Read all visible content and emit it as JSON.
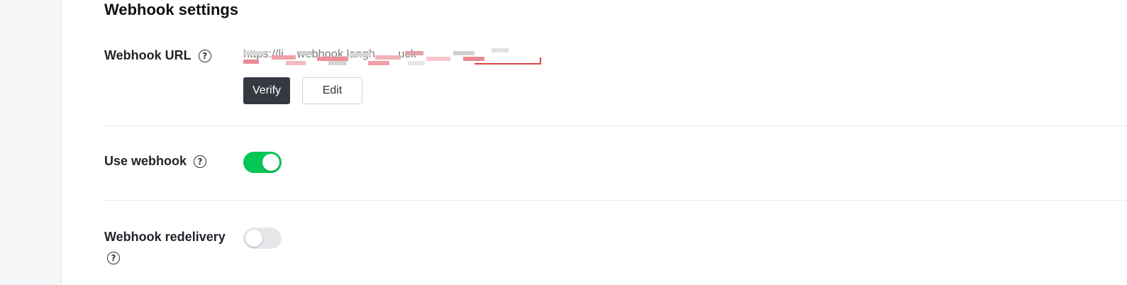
{
  "section": {
    "title": "Webhook settings"
  },
  "webhook_url": {
    "label": "Webhook URL",
    "value": "https://li... webhook.langh... ...uck",
    "verify_label": "Verify",
    "edit_label": "Edit"
  },
  "use_webhook": {
    "label": "Use webhook",
    "enabled": true
  },
  "webhook_redelivery": {
    "label": "Webhook redelivery",
    "enabled": false
  },
  "colors": {
    "toggle_on": "#06c755",
    "toggle_off": "#e5e7eb",
    "primary_button": "#353a42"
  },
  "icons": {
    "help": "question-circle-icon"
  }
}
